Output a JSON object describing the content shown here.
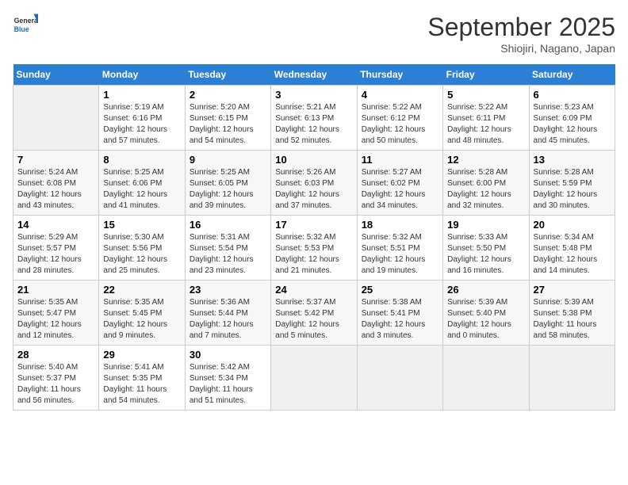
{
  "header": {
    "logo_general": "General",
    "logo_blue": "Blue",
    "month": "September 2025",
    "location": "Shiojiri, Nagano, Japan"
  },
  "days_of_week": [
    "Sunday",
    "Monday",
    "Tuesday",
    "Wednesday",
    "Thursday",
    "Friday",
    "Saturday"
  ],
  "weeks": [
    [
      {
        "day": "",
        "info": ""
      },
      {
        "day": "1",
        "info": "Sunrise: 5:19 AM\nSunset: 6:16 PM\nDaylight: 12 hours\nand 57 minutes."
      },
      {
        "day": "2",
        "info": "Sunrise: 5:20 AM\nSunset: 6:15 PM\nDaylight: 12 hours\nand 54 minutes."
      },
      {
        "day": "3",
        "info": "Sunrise: 5:21 AM\nSunset: 6:13 PM\nDaylight: 12 hours\nand 52 minutes."
      },
      {
        "day": "4",
        "info": "Sunrise: 5:22 AM\nSunset: 6:12 PM\nDaylight: 12 hours\nand 50 minutes."
      },
      {
        "day": "5",
        "info": "Sunrise: 5:22 AM\nSunset: 6:11 PM\nDaylight: 12 hours\nand 48 minutes."
      },
      {
        "day": "6",
        "info": "Sunrise: 5:23 AM\nSunset: 6:09 PM\nDaylight: 12 hours\nand 45 minutes."
      }
    ],
    [
      {
        "day": "7",
        "info": "Sunrise: 5:24 AM\nSunset: 6:08 PM\nDaylight: 12 hours\nand 43 minutes."
      },
      {
        "day": "8",
        "info": "Sunrise: 5:25 AM\nSunset: 6:06 PM\nDaylight: 12 hours\nand 41 minutes."
      },
      {
        "day": "9",
        "info": "Sunrise: 5:25 AM\nSunset: 6:05 PM\nDaylight: 12 hours\nand 39 minutes."
      },
      {
        "day": "10",
        "info": "Sunrise: 5:26 AM\nSunset: 6:03 PM\nDaylight: 12 hours\nand 37 minutes."
      },
      {
        "day": "11",
        "info": "Sunrise: 5:27 AM\nSunset: 6:02 PM\nDaylight: 12 hours\nand 34 minutes."
      },
      {
        "day": "12",
        "info": "Sunrise: 5:28 AM\nSunset: 6:00 PM\nDaylight: 12 hours\nand 32 minutes."
      },
      {
        "day": "13",
        "info": "Sunrise: 5:28 AM\nSunset: 5:59 PM\nDaylight: 12 hours\nand 30 minutes."
      }
    ],
    [
      {
        "day": "14",
        "info": "Sunrise: 5:29 AM\nSunset: 5:57 PM\nDaylight: 12 hours\nand 28 minutes."
      },
      {
        "day": "15",
        "info": "Sunrise: 5:30 AM\nSunset: 5:56 PM\nDaylight: 12 hours\nand 25 minutes."
      },
      {
        "day": "16",
        "info": "Sunrise: 5:31 AM\nSunset: 5:54 PM\nDaylight: 12 hours\nand 23 minutes."
      },
      {
        "day": "17",
        "info": "Sunrise: 5:32 AM\nSunset: 5:53 PM\nDaylight: 12 hours\nand 21 minutes."
      },
      {
        "day": "18",
        "info": "Sunrise: 5:32 AM\nSunset: 5:51 PM\nDaylight: 12 hours\nand 19 minutes."
      },
      {
        "day": "19",
        "info": "Sunrise: 5:33 AM\nSunset: 5:50 PM\nDaylight: 12 hours\nand 16 minutes."
      },
      {
        "day": "20",
        "info": "Sunrise: 5:34 AM\nSunset: 5:48 PM\nDaylight: 12 hours\nand 14 minutes."
      }
    ],
    [
      {
        "day": "21",
        "info": "Sunrise: 5:35 AM\nSunset: 5:47 PM\nDaylight: 12 hours\nand 12 minutes."
      },
      {
        "day": "22",
        "info": "Sunrise: 5:35 AM\nSunset: 5:45 PM\nDaylight: 12 hours\nand 9 minutes."
      },
      {
        "day": "23",
        "info": "Sunrise: 5:36 AM\nSunset: 5:44 PM\nDaylight: 12 hours\nand 7 minutes."
      },
      {
        "day": "24",
        "info": "Sunrise: 5:37 AM\nSunset: 5:42 PM\nDaylight: 12 hours\nand 5 minutes."
      },
      {
        "day": "25",
        "info": "Sunrise: 5:38 AM\nSunset: 5:41 PM\nDaylight: 12 hours\nand 3 minutes."
      },
      {
        "day": "26",
        "info": "Sunrise: 5:39 AM\nSunset: 5:40 PM\nDaylight: 12 hours\nand 0 minutes."
      },
      {
        "day": "27",
        "info": "Sunrise: 5:39 AM\nSunset: 5:38 PM\nDaylight: 11 hours\nand 58 minutes."
      }
    ],
    [
      {
        "day": "28",
        "info": "Sunrise: 5:40 AM\nSunset: 5:37 PM\nDaylight: 11 hours\nand 56 minutes."
      },
      {
        "day": "29",
        "info": "Sunrise: 5:41 AM\nSunset: 5:35 PM\nDaylight: 11 hours\nand 54 minutes."
      },
      {
        "day": "30",
        "info": "Sunrise: 5:42 AM\nSunset: 5:34 PM\nDaylight: 11 hours\nand 51 minutes."
      },
      {
        "day": "",
        "info": ""
      },
      {
        "day": "",
        "info": ""
      },
      {
        "day": "",
        "info": ""
      },
      {
        "day": "",
        "info": ""
      }
    ]
  ]
}
